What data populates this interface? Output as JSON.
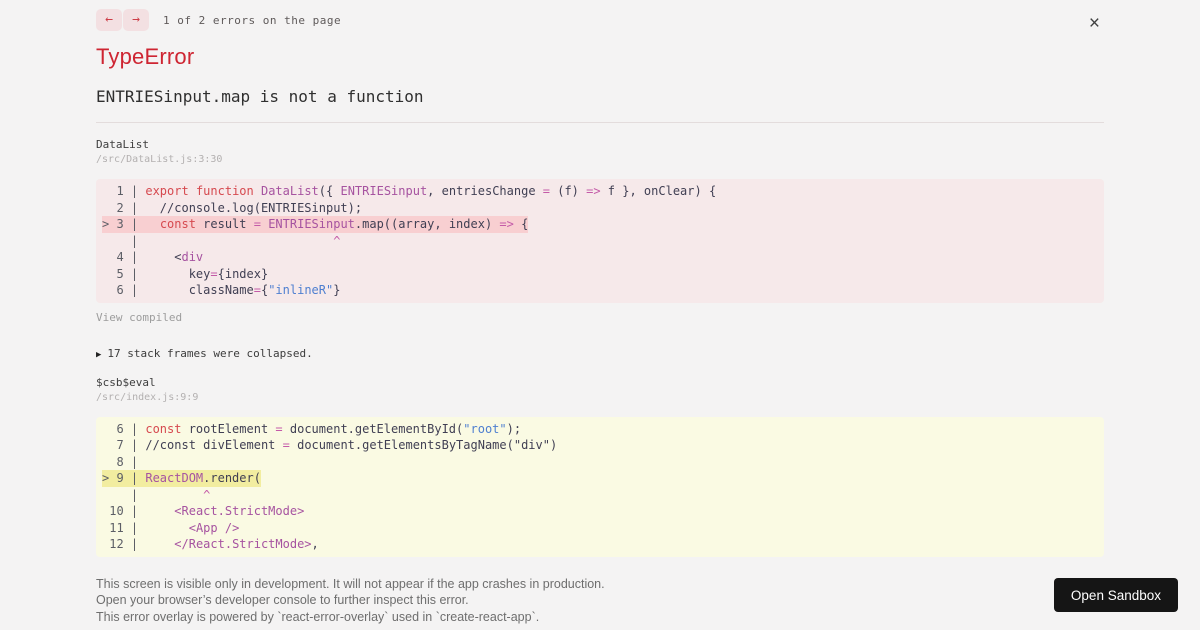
{
  "nav": {
    "left_arrow": "←",
    "right_arrow": "→",
    "position": "1 of 2 errors on the page",
    "close": "×"
  },
  "error": {
    "title": "TypeError",
    "message": "ENTRIESinput.map is not a function"
  },
  "frames": [
    {
      "fn": "DataList",
      "path": "/src/DataList.js:3:30"
    },
    {
      "fn": "$csb$eval",
      "path": "/src/index.js:9:9"
    }
  ],
  "view_compiled": "View compiled",
  "stack_collapse": {
    "triangle": "▶",
    "label": "17 stack frames were collapsed."
  },
  "footer": {
    "lines": [
      "This screen is visible only in development. It will not appear if the app crashes in production.",
      "Open your browser’s developer console to further inspect this error.",
      "This error overlay is powered by `react-error-overlay` used in `create-react-app`."
    ],
    "open_sandbox": "Open Sandbox"
  },
  "syntax": {
    "k": "#d6494f",
    "i": "#a653a0",
    "o": "#c45ba8",
    "s": "#4e7fd0",
    "p": "#403f53",
    "x": "#c45ba8"
  },
  "code_blocks": [
    {
      "bg": "#f6e9ea",
      "hl_color": "#f8cfd1",
      "lines": [
        {
          "g": "  1 | ",
          "hl": false,
          "t": [
            [
              "k",
              "export"
            ],
            [
              "p",
              " "
            ],
            [
              "k",
              "function"
            ],
            [
              "p",
              " "
            ],
            [
              "i",
              "DataList"
            ],
            [
              "p",
              "({ "
            ],
            [
              "i",
              "ENTRIESinput"
            ],
            [
              "p",
              ", entriesChange "
            ],
            [
              "o",
              "="
            ],
            [
              "p",
              " (f) "
            ],
            [
              "o",
              "=>"
            ],
            [
              "p",
              " f }, onClear) {"
            ]
          ]
        },
        {
          "g": "  2 | ",
          "hl": false,
          "t": [
            [
              "p",
              "  //console.log(ENTRIESinput);"
            ]
          ]
        },
        {
          "g": "> 3 | ",
          "hl": true,
          "t": [
            [
              "p",
              "  "
            ],
            [
              "k",
              "const"
            ],
            [
              "p",
              " result "
            ],
            [
              "o",
              "="
            ],
            [
              "p",
              " "
            ],
            [
              "i",
              "ENTRIESinput"
            ],
            [
              "p",
              ".map((array, index) "
            ],
            [
              "o",
              "=>"
            ],
            [
              "p",
              " {"
            ]
          ]
        },
        {
          "g": "    | ",
          "hl": false,
          "t": [
            [
              "p",
              "                          "
            ],
            [
              "x",
              "^"
            ]
          ]
        },
        {
          "g": "  4 | ",
          "hl": false,
          "t": [
            [
              "p",
              "    <"
            ],
            [
              "i",
              "div"
            ]
          ]
        },
        {
          "g": "  5 | ",
          "hl": false,
          "t": [
            [
              "p",
              "      key"
            ],
            [
              "o",
              "="
            ],
            [
              "p",
              "{index}"
            ]
          ]
        },
        {
          "g": "  6 | ",
          "hl": false,
          "t": [
            [
              "p",
              "      className"
            ],
            [
              "o",
              "="
            ],
            [
              "p",
              "{"
            ],
            [
              "s",
              "\"inlineR\""
            ],
            [
              "p",
              "}"
            ]
          ]
        }
      ]
    },
    {
      "bg": "#fafae3",
      "hl_color": "#f2eda0",
      "lines": [
        {
          "g": "  6 | ",
          "hl": false,
          "t": [
            [
              "k",
              "const"
            ],
            [
              "p",
              " rootElement "
            ],
            [
              "o",
              "="
            ],
            [
              "p",
              " document.getElementById("
            ],
            [
              "s",
              "\"root\""
            ],
            [
              "p",
              ");"
            ]
          ]
        },
        {
          "g": "  7 | ",
          "hl": false,
          "t": [
            [
              "p",
              "//const divElement "
            ],
            [
              "o",
              "="
            ],
            [
              "p",
              " document.getElementsByTagName(\"div\")"
            ]
          ]
        },
        {
          "g": "  8 | ",
          "hl": false,
          "t": []
        },
        {
          "g": "> 9 | ",
          "hl": true,
          "t": [
            [
              "i",
              "ReactDOM"
            ],
            [
              "p",
              ".render("
            ]
          ]
        },
        {
          "g": "    | ",
          "hl": false,
          "t": [
            [
              "p",
              "        "
            ],
            [
              "x",
              "^"
            ]
          ]
        },
        {
          "g": " 10 | ",
          "hl": false,
          "t": [
            [
              "p",
              "    "
            ],
            [
              "i",
              "<React.StrictMode>"
            ]
          ]
        },
        {
          "g": " 11 | ",
          "hl": false,
          "t": [
            [
              "p",
              "      "
            ],
            [
              "i",
              "<App />"
            ]
          ]
        },
        {
          "g": " 12 | ",
          "hl": false,
          "t": [
            [
              "p",
              "    "
            ],
            [
              "i",
              "</React.StrictMode>"
            ],
            [
              "p",
              ","
            ]
          ]
        }
      ]
    }
  ]
}
